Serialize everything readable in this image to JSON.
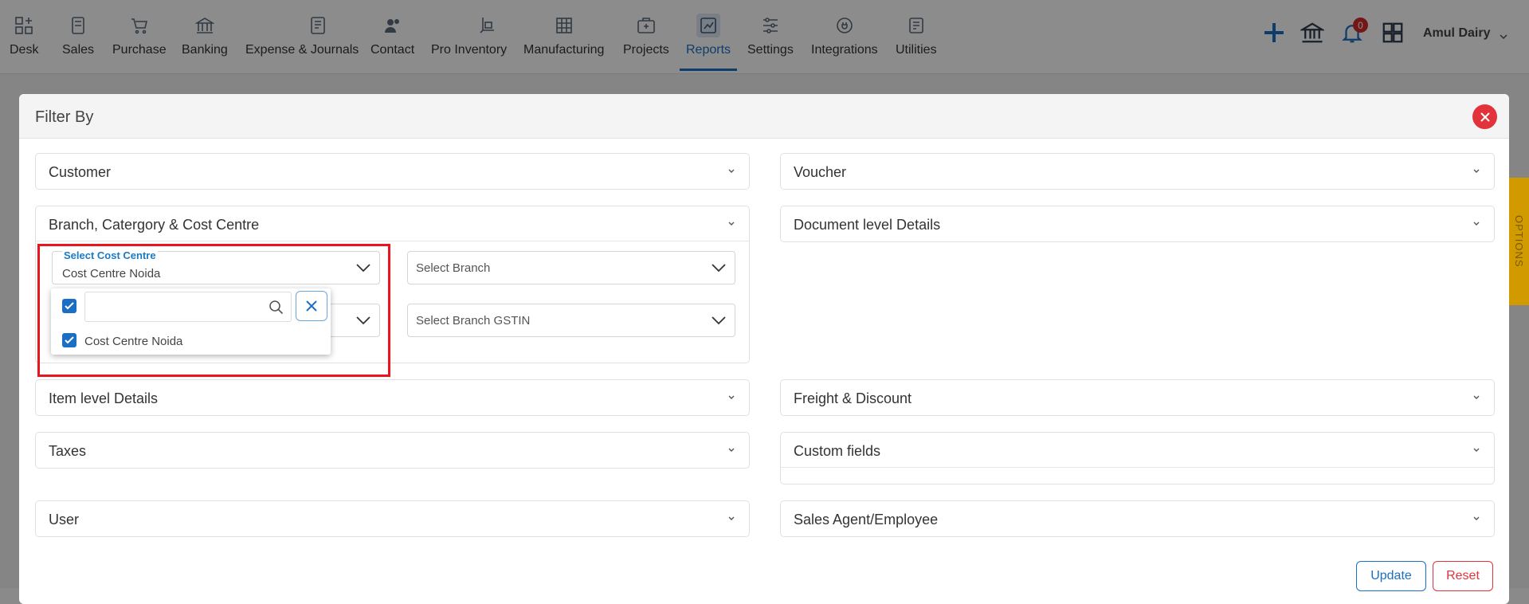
{
  "nav": {
    "items": [
      {
        "label": "Desk",
        "icon": "desk-icon"
      },
      {
        "label": "Sales",
        "icon": "sales-icon"
      },
      {
        "label": "Purchase",
        "icon": "cart-icon"
      },
      {
        "label": "Banking",
        "icon": "bank-icon"
      },
      {
        "label": "Expense & Journals",
        "icon": "journal-icon"
      },
      {
        "label": "Contact",
        "icon": "contacts-icon"
      },
      {
        "label": "Pro Inventory",
        "icon": "inventory-icon"
      },
      {
        "label": "Manufacturing",
        "icon": "factory-icon"
      },
      {
        "label": "Projects",
        "icon": "projects-icon"
      },
      {
        "label": "Reports",
        "icon": "reports-icon",
        "active": true
      },
      {
        "label": "Settings",
        "icon": "sliders-icon"
      },
      {
        "label": "Integrations",
        "icon": "plug-icon"
      },
      {
        "label": "Utilities",
        "icon": "utilities-icon"
      }
    ],
    "notification_count": "0",
    "company": "Amul Dairy"
  },
  "side_tab": "OPTIONS",
  "modal": {
    "title": "Filter By",
    "left_sections": {
      "customer": "Customer",
      "branch": "Branch, Catergory & Cost Centre",
      "item": "Item level Details",
      "taxes": "Taxes",
      "user": "User"
    },
    "right_sections": {
      "voucher": "Voucher",
      "document": "Document level Details",
      "freight": "Freight & Discount",
      "custom": "Custom fields",
      "agent": "Sales Agent/Employee"
    },
    "cost_centre": {
      "label": "Select Cost Centre",
      "value": "Cost Centre Noida",
      "search_placeholder": "",
      "options": [
        {
          "label": "Cost Centre Noida",
          "checked": true
        }
      ]
    },
    "select_branch": "Select Branch",
    "select_branch_gstin": "Select Branch GSTIN",
    "buttons": {
      "update": "Update",
      "reset": "Reset"
    }
  },
  "colors": {
    "accent": "#1a6fc4",
    "danger": "#e2323c",
    "highlight": "#e8141e",
    "options_tab": "#d19b00"
  }
}
